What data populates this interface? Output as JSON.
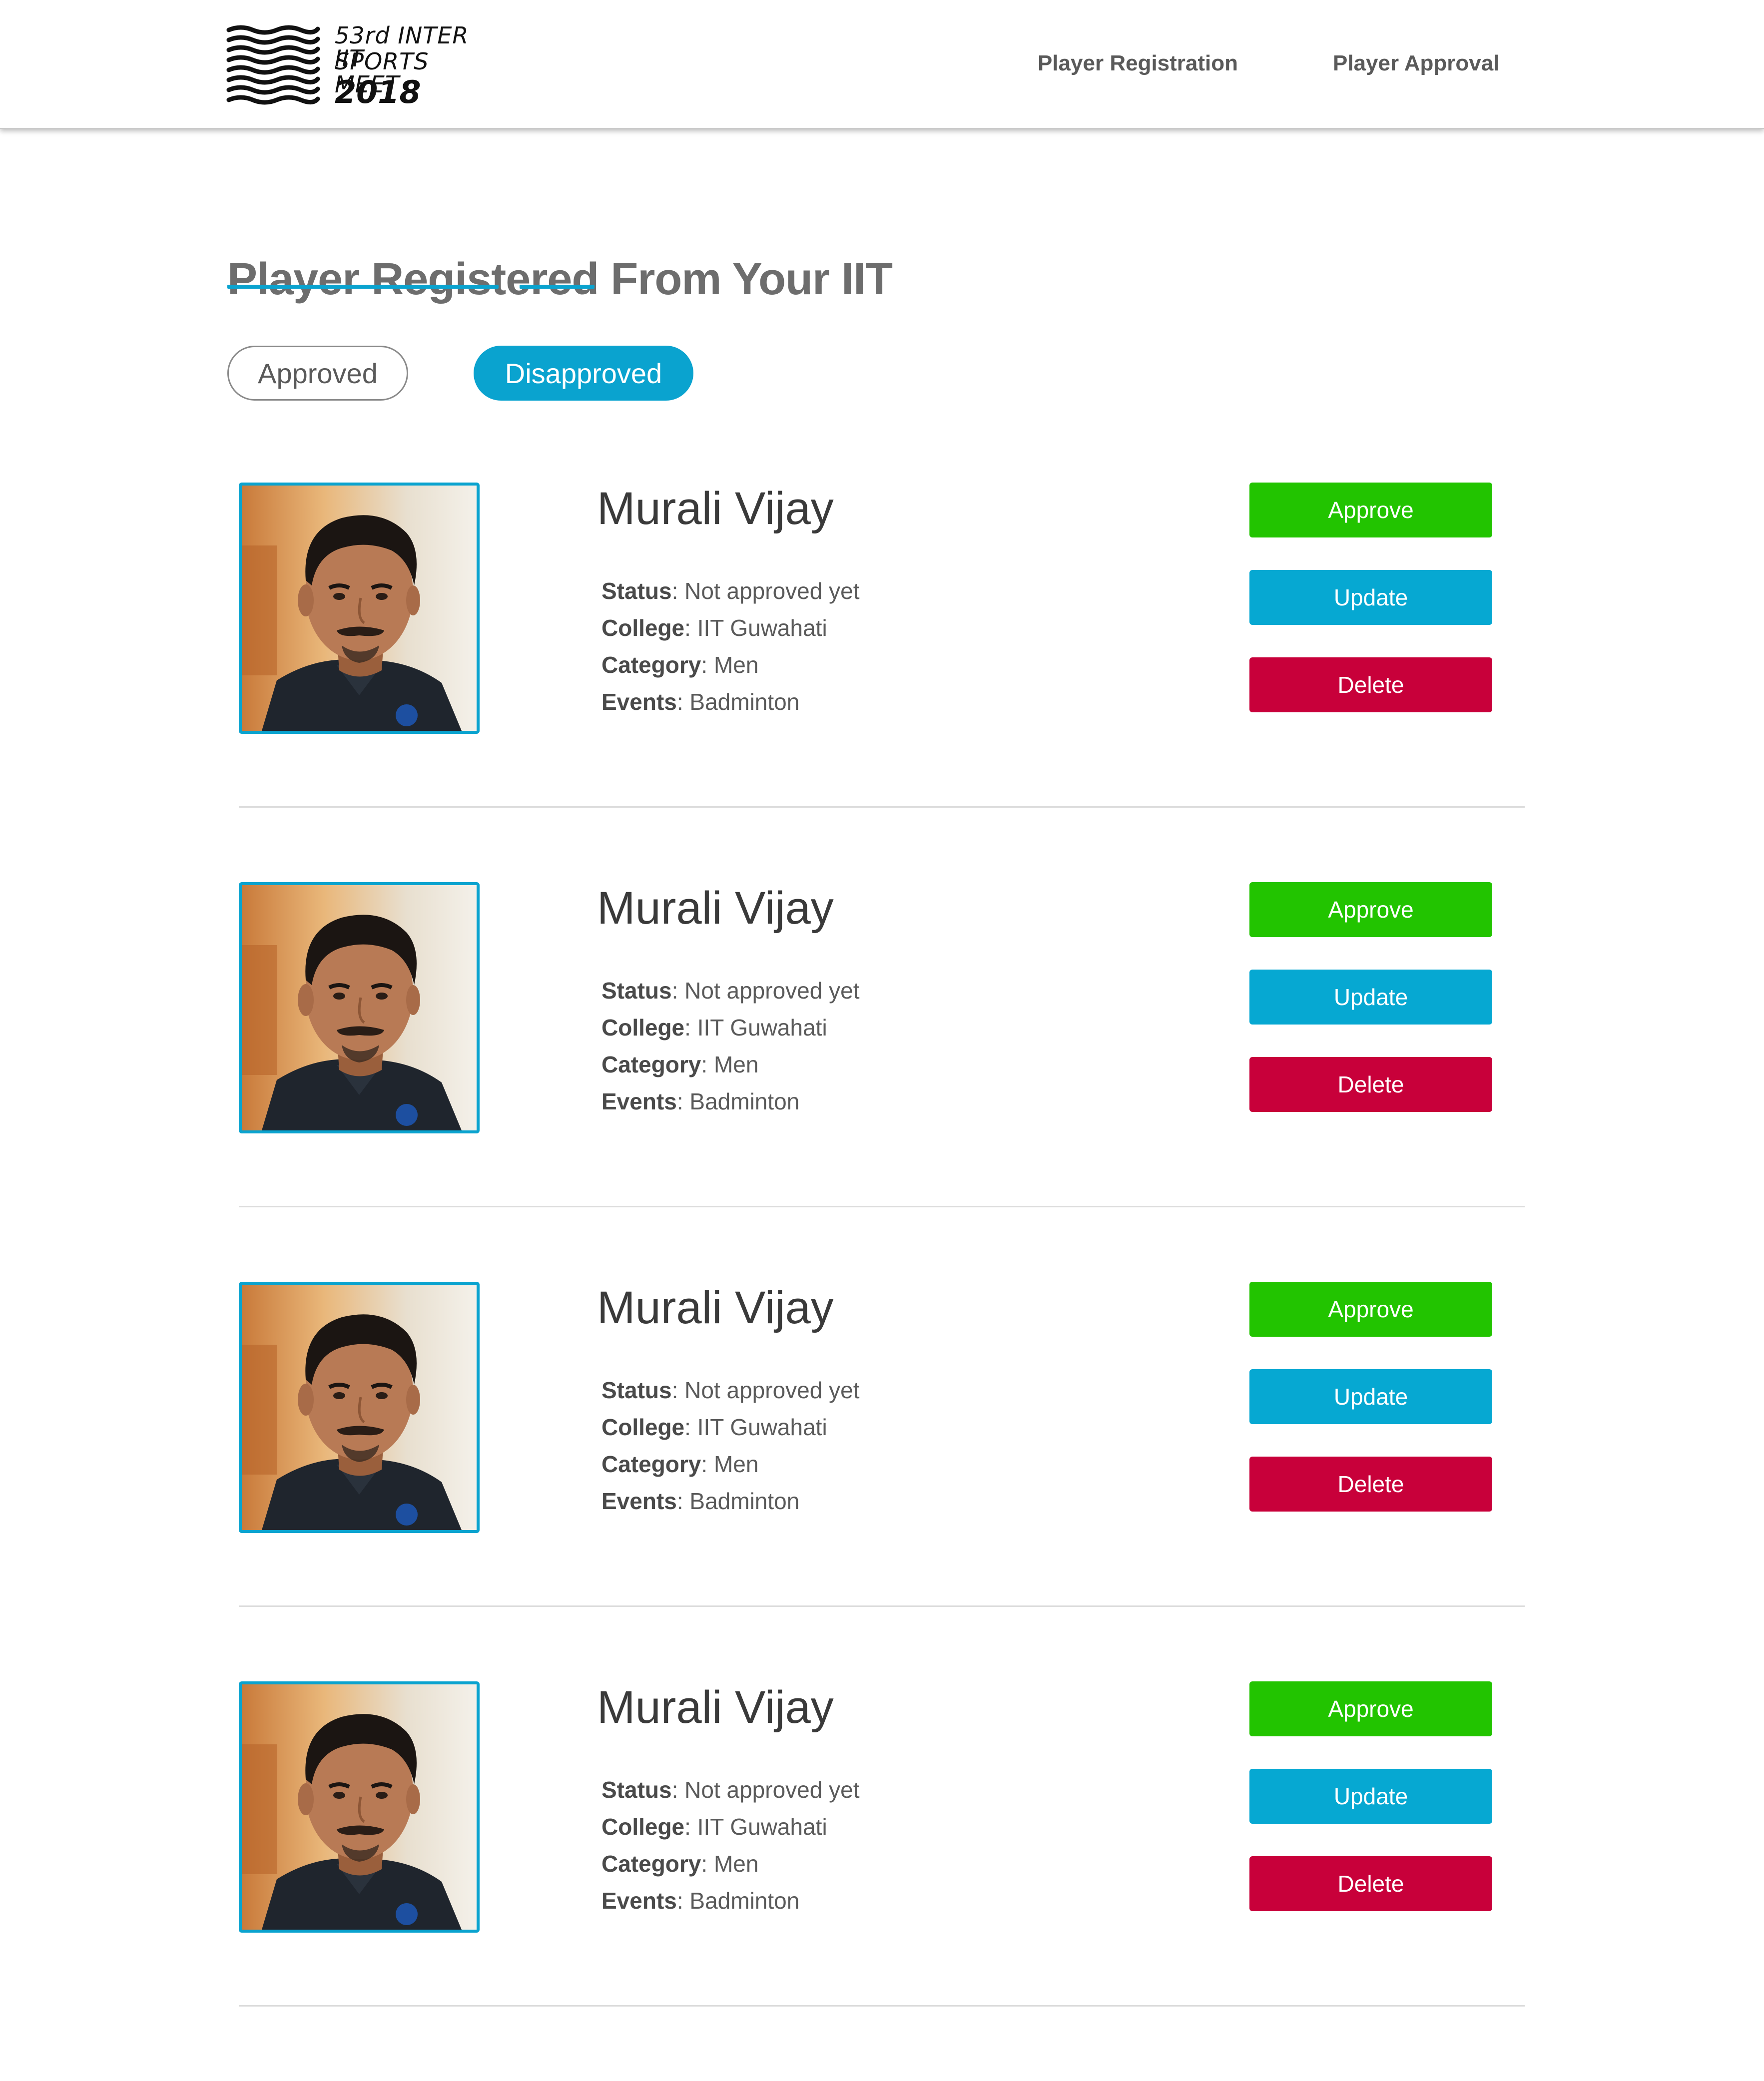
{
  "header": {
    "logo": {
      "line1": "53rd INTER IIT",
      "line2": "SPORTS MEET",
      "line3": "2018"
    },
    "nav": [
      {
        "label": "Player Registration"
      },
      {
        "label": "Player Approval"
      }
    ]
  },
  "main": {
    "title": "Player Registered From Your IIT",
    "filters": {
      "approved_label": "Approved",
      "disapproved_label": "Disapproved",
      "active": "Disapproved"
    },
    "field_labels": {
      "status": "Status",
      "college": "College",
      "category": "Category",
      "events": "Events"
    },
    "actions": {
      "approve": "Approve",
      "update": "Update",
      "delete": "Delete"
    },
    "players": [
      {
        "name": "Murali Vijay",
        "status": "Not approved yet",
        "college": "IIT Guwahati",
        "category": "Men",
        "events": "Badminton"
      },
      {
        "name": "Murali Vijay",
        "status": "Not approved yet",
        "college": "IIT Guwahati",
        "category": "Men",
        "events": "Badminton"
      },
      {
        "name": "Murali Vijay",
        "status": "Not approved yet",
        "college": "IIT Guwahati",
        "category": "Men",
        "events": "Badminton"
      },
      {
        "name": "Murali Vijay",
        "status": "Not approved yet",
        "college": "IIT Guwahati",
        "category": "Men",
        "events": "Badminton"
      }
    ]
  },
  "colors": {
    "accent": "#0aa3cf",
    "approve": "#22c400",
    "update": "#06a8d2",
    "delete": "#c8003a"
  }
}
